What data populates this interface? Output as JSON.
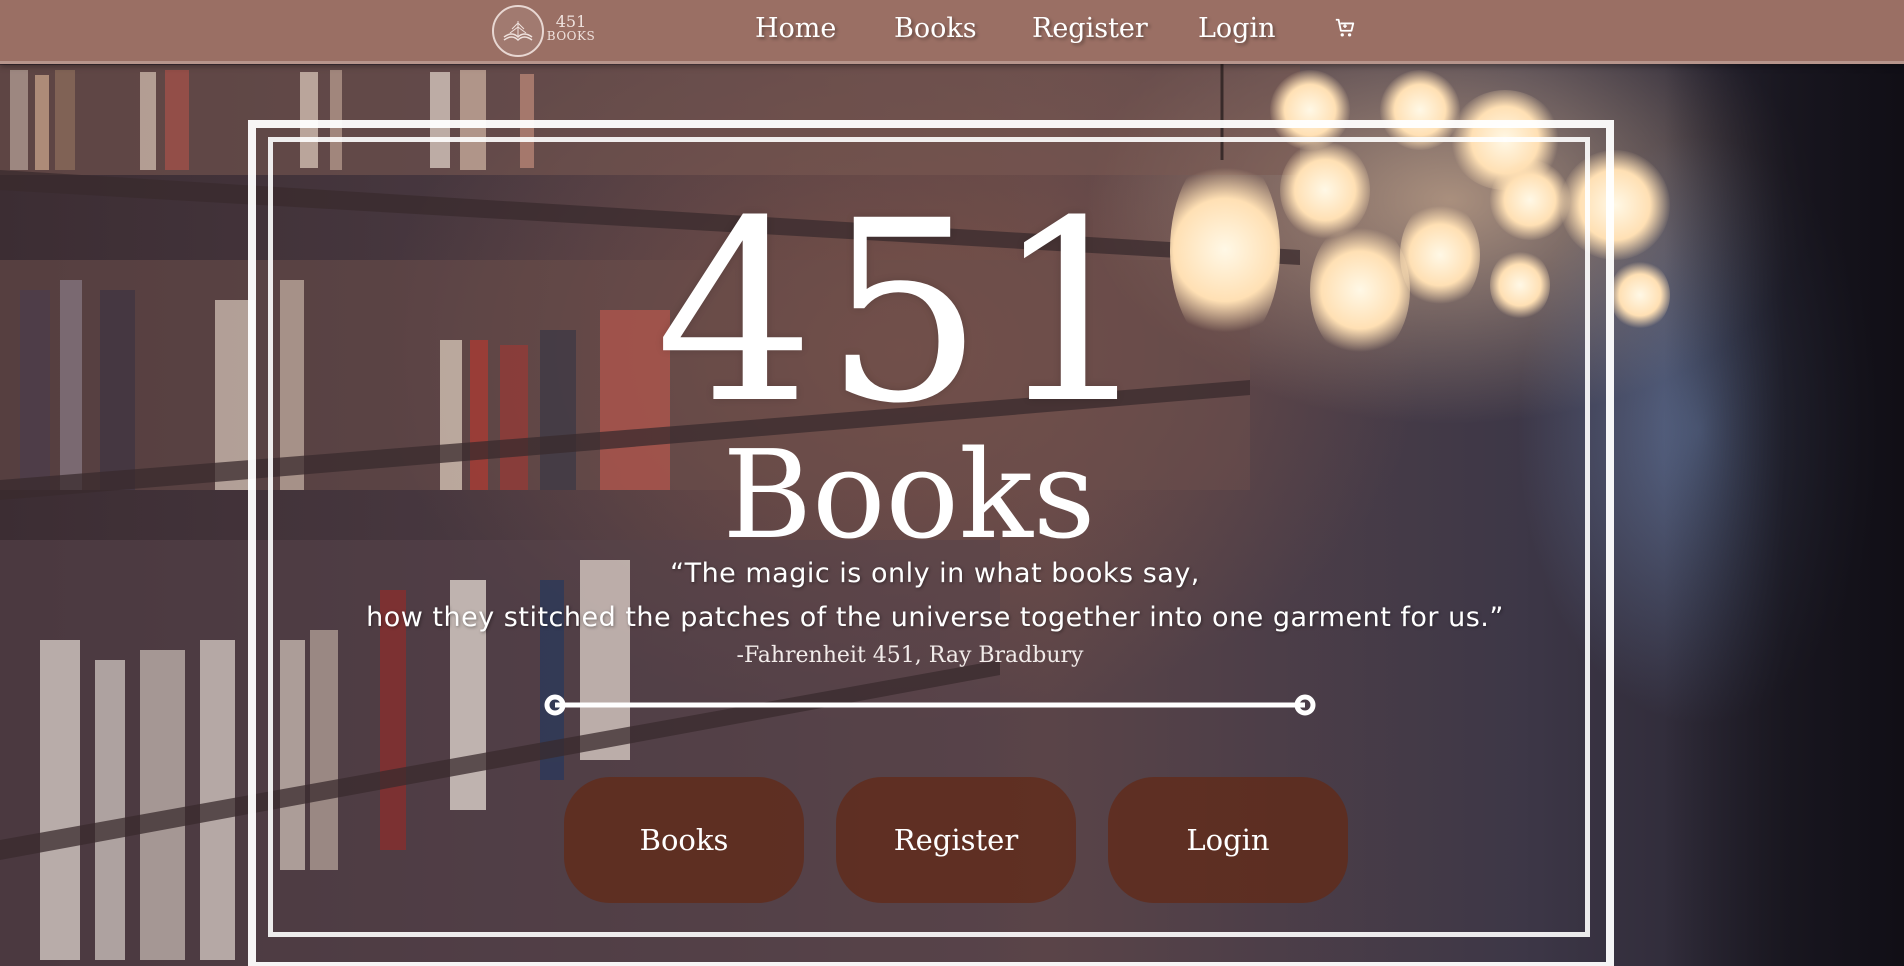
{
  "brand": {
    "logo_number": "451",
    "logo_word": "BOOKS",
    "icon": "open-book-logo-icon"
  },
  "nav": {
    "items": [
      {
        "label": "Home"
      },
      {
        "label": "Books"
      },
      {
        "label": "Register"
      },
      {
        "label": "Login"
      }
    ],
    "cart_icon": "cart-icon"
  },
  "hero": {
    "title_number": "451",
    "title_word": "Books",
    "quote_line1": "“The magic is only in what books say,",
    "quote_line2": "how they stitched the patches of the universe together into one garment for us.”",
    "attribution": "-Fahrenheit 451, Ray Bradbury"
  },
  "actions": {
    "books_label": "Books",
    "register_label": "Register",
    "login_label": "Login"
  },
  "colors": {
    "navbar": "#9a6f64",
    "button": "#62291a",
    "text": "#ffffff"
  }
}
